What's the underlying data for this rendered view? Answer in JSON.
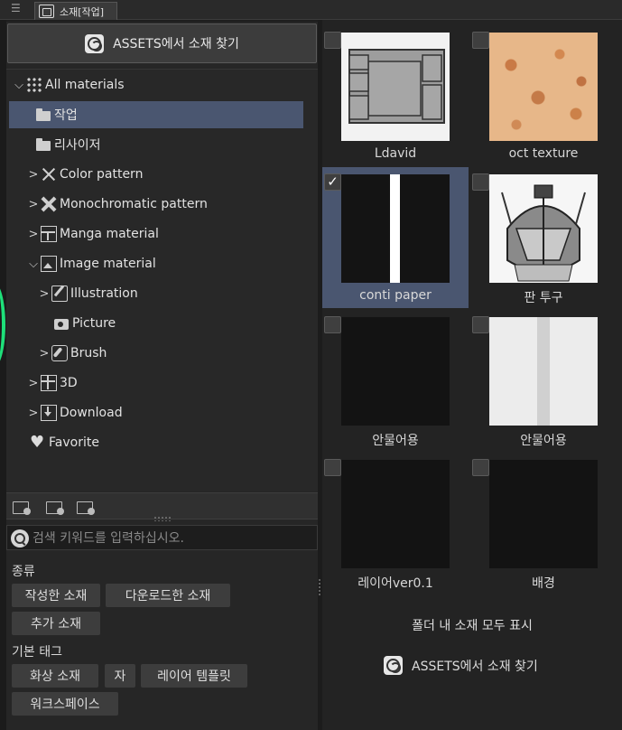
{
  "tab": {
    "title": "소재[작업]"
  },
  "assets_button": {
    "label": "ASSETS에서 소재 찾기"
  },
  "tree": [
    {
      "label": "All materials",
      "chevron": "∨",
      "icon": "grid-dots-icon"
    },
    {
      "label": "작업",
      "chevron": "",
      "icon": "folder-icon",
      "selected": true
    },
    {
      "label": "리사이저",
      "chevron": "",
      "icon": "folder-icon"
    },
    {
      "label": "Color pattern",
      "chevron": ">",
      "icon": "scissors-icon"
    },
    {
      "label": "Monochromatic pattern",
      "chevron": ">",
      "icon": "cross-icon"
    },
    {
      "label": "Manga material",
      "chevron": ">",
      "icon": "manga-panel-icon"
    },
    {
      "label": "Image material",
      "chevron": "∨",
      "icon": "image-icon"
    },
    {
      "label": "Illustration",
      "chevron": ">",
      "icon": "pen-icon"
    },
    {
      "label": "Picture",
      "chevron": "",
      "icon": "camera-icon"
    },
    {
      "label": "Brush",
      "chevron": ">",
      "icon": "brush-icon"
    },
    {
      "label": "3D",
      "chevron": ">",
      "icon": "cube-icon"
    },
    {
      "label": "Download",
      "chevron": ">",
      "icon": "download-icon"
    },
    {
      "label": "Favorite",
      "chevron": "",
      "icon": "heart-icon"
    }
  ],
  "search": {
    "placeholder": "검색 키워드를 입력하십시오."
  },
  "kind": {
    "label": "종류",
    "chips": [
      "작성한 소재",
      "다운로드한 소재",
      "추가 소재"
    ]
  },
  "basic_tags": {
    "label": "기본 태그",
    "chips": [
      "화상 소재",
      "자",
      "레이어 템플릿",
      "워크스페이스"
    ]
  },
  "materials": [
    {
      "label": "Ldavid",
      "checked": false,
      "selected": false,
      "thumb": "layout-template"
    },
    {
      "label": "oct texture",
      "checked": false,
      "selected": false,
      "thumb": "orange-texture"
    },
    {
      "label": "conti paper",
      "checked": true,
      "selected": true,
      "thumb": "black-with-white-stripe"
    },
    {
      "label": "판 투구",
      "checked": false,
      "selected": false,
      "thumb": "helmet"
    },
    {
      "label": "안물어용",
      "checked": false,
      "selected": false,
      "thumb": "black"
    },
    {
      "label": "안물어용",
      "checked": false,
      "selected": false,
      "thumb": "light-gray-stripe"
    },
    {
      "label": "레이어ver0.1",
      "checked": false,
      "selected": false,
      "thumb": "black"
    },
    {
      "label": "배경",
      "checked": false,
      "selected": false,
      "thumb": "black"
    }
  ],
  "show_all": {
    "label": "폴더 내 소재 모두 표시"
  },
  "assets_link": {
    "label": "ASSETS에서 소재 찾기"
  },
  "colors": {
    "selection": "#4a5670",
    "accent_green": "#1ee07a"
  }
}
